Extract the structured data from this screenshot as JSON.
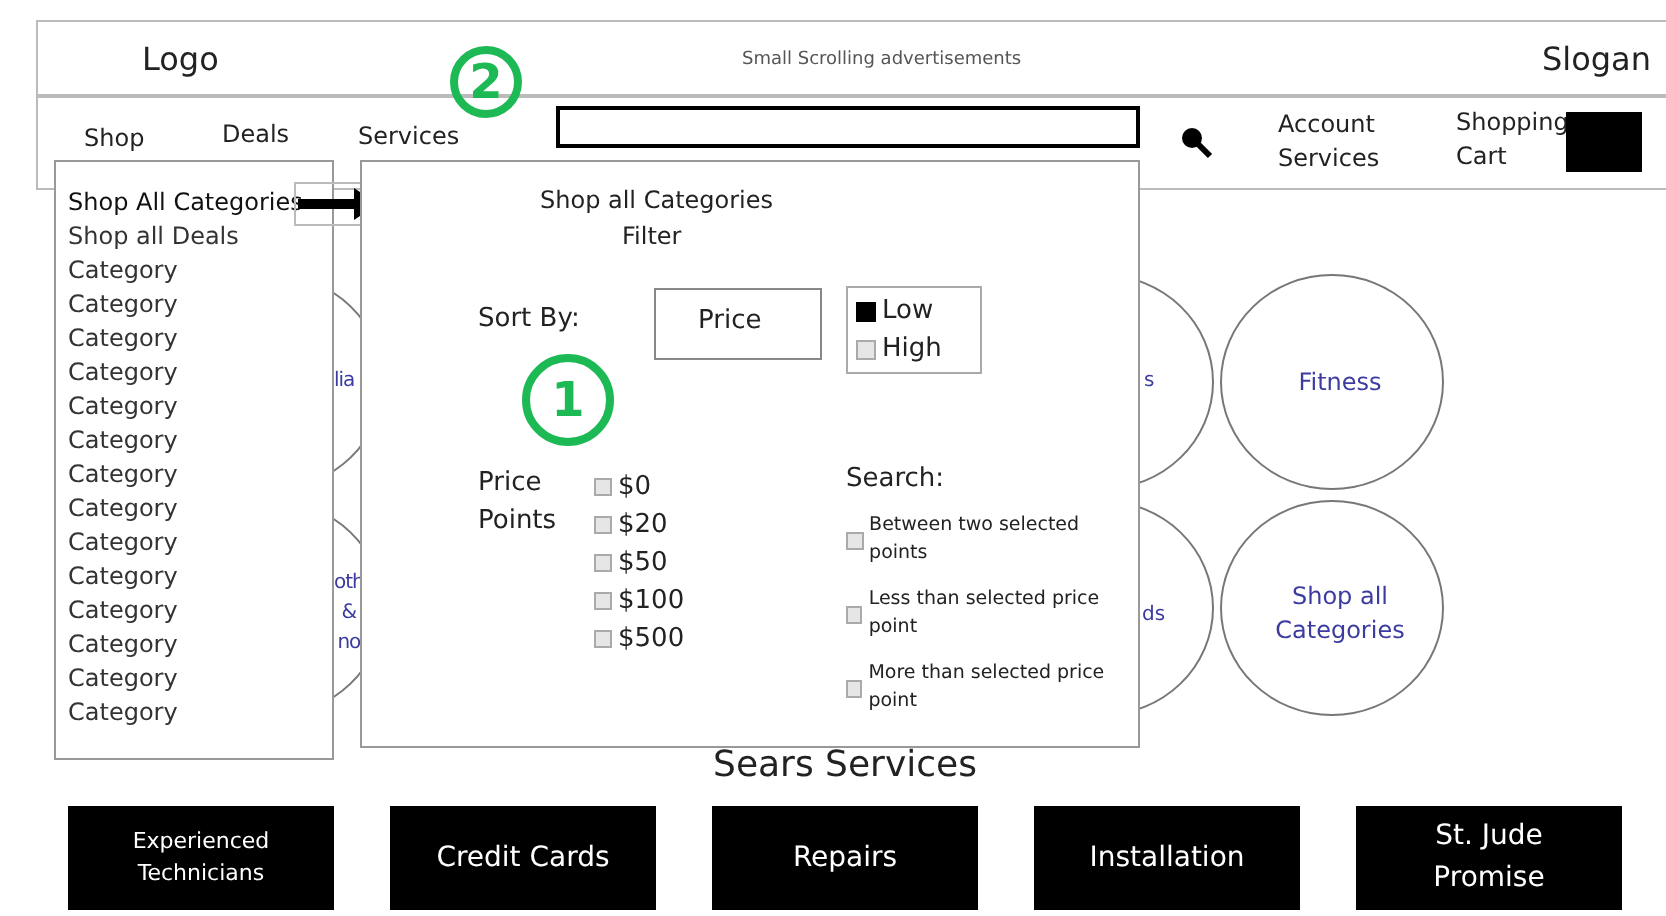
{
  "header": {
    "logo": "Logo",
    "ad": "Small Scrolling advertisements",
    "slogan": "Slogan"
  },
  "nav": {
    "items": [
      "Shop",
      "Deals",
      "Services"
    ],
    "account": "Account\nServices",
    "cart": "Shopping\nCart"
  },
  "annotations": [
    {
      "label": "2"
    },
    {
      "label": "1"
    }
  ],
  "circles": [
    {
      "fragment": "lia"
    },
    {
      "fragment": "oth\n&\nno"
    },
    {
      "fragment": "s"
    },
    {
      "fragment": "ds"
    },
    {
      "fragment": "Fitness"
    },
    {
      "fragment": "Shop all\nCategories"
    }
  ],
  "menu": {
    "items": [
      {
        "label": "Shop All Categories",
        "selected": true
      },
      {
        "label": "Shop all Deals",
        "selected": false
      },
      {
        "label": "Category",
        "selected": false
      },
      {
        "label": "Category",
        "selected": false
      },
      {
        "label": "Category",
        "selected": false
      },
      {
        "label": "Category",
        "selected": false
      },
      {
        "label": "Category",
        "selected": false
      },
      {
        "label": "Category",
        "selected": false
      },
      {
        "label": "Category",
        "selected": false
      },
      {
        "label": "Category",
        "selected": false
      },
      {
        "label": "Category",
        "selected": false
      },
      {
        "label": "Category",
        "selected": false
      },
      {
        "label": "Category",
        "selected": false
      },
      {
        "label": "Category",
        "selected": false
      },
      {
        "label": "Category",
        "selected": false
      },
      {
        "label": "Category",
        "selected": false
      }
    ]
  },
  "filter": {
    "title": "Shop all Categories",
    "subtitle": "Filter",
    "sort_label": "Sort By:",
    "sort_field": "Price",
    "order": [
      {
        "label": "Low",
        "checked": true
      },
      {
        "label": "High",
        "checked": false
      }
    ],
    "price_label": "Price\nPoints",
    "prices": [
      {
        "label": "$0",
        "checked": false
      },
      {
        "label": "$20",
        "checked": false
      },
      {
        "label": "$50",
        "checked": false
      },
      {
        "label": "$100",
        "checked": false
      },
      {
        "label": "$500",
        "checked": false
      }
    ],
    "search_label": "Search:",
    "search_options": [
      {
        "label": "Between two selected points",
        "checked": false
      },
      {
        "label": "Less than selected price point",
        "checked": false
      },
      {
        "label": "More than selected price point",
        "checked": false
      }
    ]
  },
  "services": {
    "title": "Sears Services",
    "buttons": [
      "Experienced\nTechnicians",
      "Credit Cards",
      "Repairs",
      "Installation",
      "St. Jude\nPromise"
    ]
  }
}
